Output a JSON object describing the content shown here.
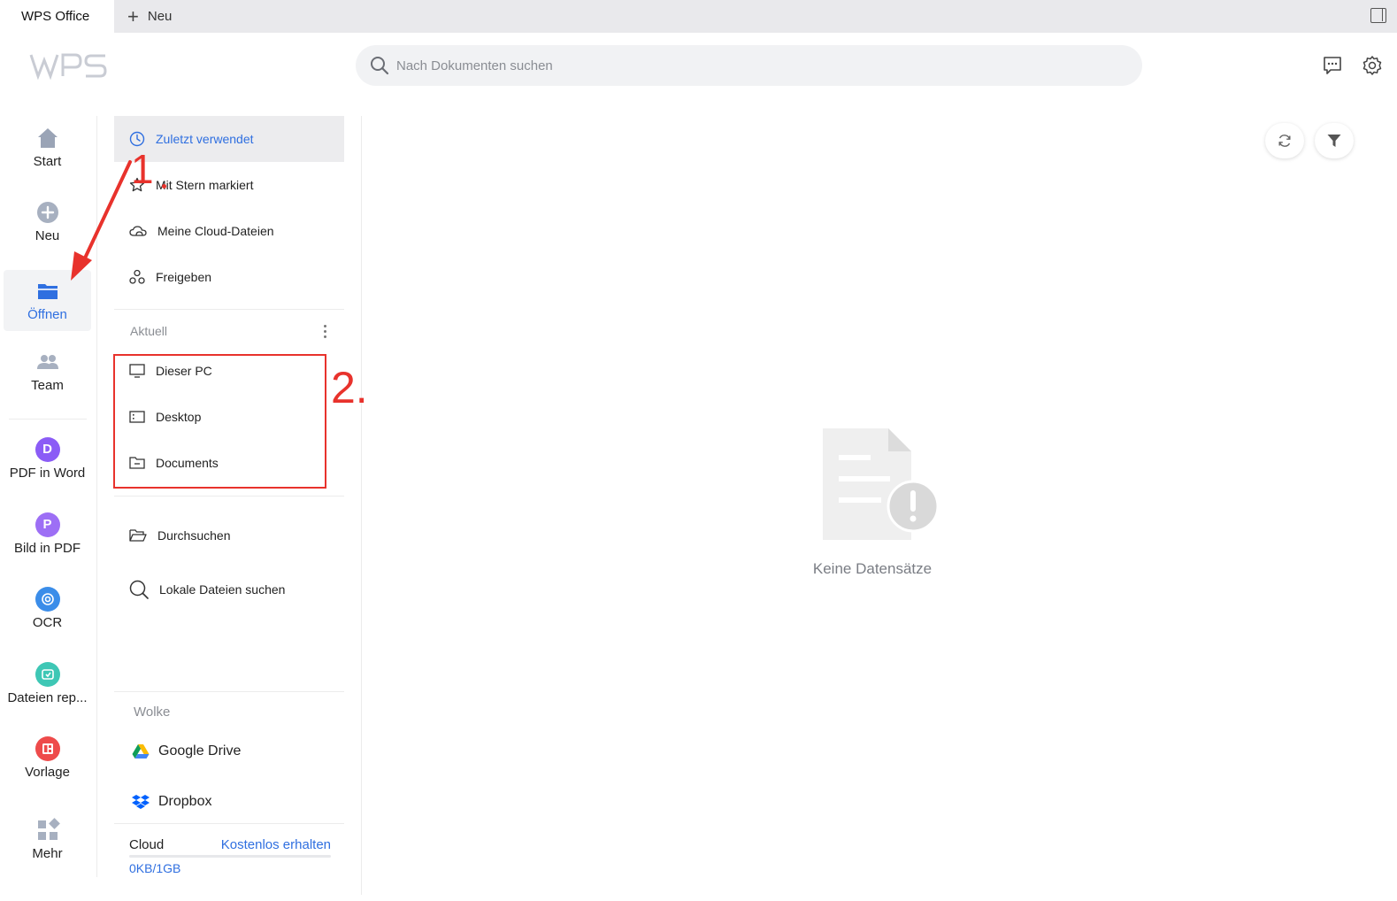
{
  "tabs": {
    "active_label": "WPS Office",
    "new_label": "Neu"
  },
  "search": {
    "placeholder": "Nach Dokumenten suchen"
  },
  "leftnav": {
    "start": "Start",
    "new": "Neu",
    "open": "Öffnen",
    "team": "Team",
    "pdf_to_word": "PDF in Word",
    "image_to_pdf": "Bild in PDF",
    "ocr": "OCR",
    "repair": "Dateien rep...",
    "template": "Vorlage",
    "more": "Mehr"
  },
  "midpanel": {
    "recent": "Zuletzt verwendet",
    "starred": "Mit Stern markiert",
    "cloud_files": "Meine Cloud-Dateien",
    "share": "Freigeben",
    "current_label": "Aktuell",
    "this_pc": "Dieser PC",
    "desktop": "Desktop",
    "documents": "Documents",
    "browse": "Durchsuchen",
    "search_local": "Lokale Dateien suchen",
    "cloud_label": "Wolke",
    "google_drive": "Google Drive",
    "dropbox": "Dropbox",
    "storage_label": "Cloud",
    "get_free": "Kostenlos erhalten",
    "storage_value": "0KB/1GB",
    "storage_used_fraction": 0
  },
  "main": {
    "empty_text": "Keine Datensätze"
  },
  "annotations": {
    "step1": "1",
    "step2": "2."
  },
  "colors": {
    "accent": "#2f6fe0",
    "annotation": "#e8322c",
    "pdf_word": "#8b5cf6",
    "image_pdf": "#9d6ff5",
    "ocr": "#3b8de9",
    "repair": "#3ec7b5",
    "template": "#ee4b4b"
  }
}
